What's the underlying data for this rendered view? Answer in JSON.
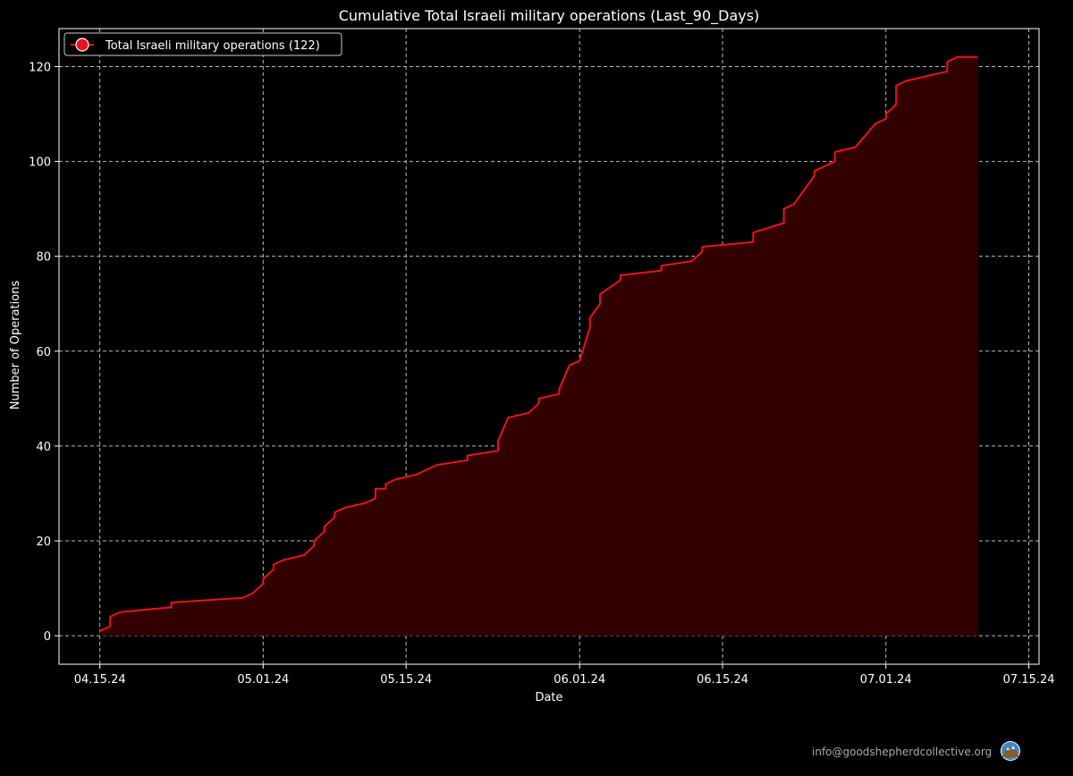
{
  "chart_data": {
    "type": "line",
    "title": "Cumulative Total Israeli military operations (Last_90_Days)",
    "xlabel": "Date",
    "ylabel": "Number of Operations",
    "x_tick_labels": [
      "04.15.24",
      "05.01.24",
      "05.15.24",
      "06.01.24",
      "06.15.24",
      "07.01.24",
      "07.15.24"
    ],
    "x_ticks": [
      "2024-04-15",
      "2024-05-01",
      "2024-05-15",
      "2024-06-01",
      "2024-06-15",
      "2024-07-01",
      "2024-07-15"
    ],
    "xlim": [
      "2024-04-11",
      "2024-07-16"
    ],
    "y_ticks": [
      0,
      20,
      40,
      60,
      80,
      100,
      120
    ],
    "ylim": [
      -6,
      128
    ],
    "grid": true,
    "legend": {
      "position": "top-left",
      "label": "Total Israeli military operations (122)"
    },
    "colors": {
      "line": "#e8141c",
      "fill": "#330000",
      "grid": "#bbbbbb",
      "background": "#000000"
    },
    "series": [
      {
        "name": "Total Israeli military operations (122)",
        "x": [
          "2024-04-15",
          "2024-04-16",
          "2024-04-16",
          "2024-04-17",
          "2024-04-22",
          "2024-04-22",
          "2024-04-29",
          "2024-04-30",
          "2024-05-01",
          "2024-05-01",
          "2024-05-02",
          "2024-05-02",
          "2024-05-03",
          "2024-05-05",
          "2024-05-06",
          "2024-05-06",
          "2024-05-07",
          "2024-05-07",
          "2024-05-08",
          "2024-05-08",
          "2024-05-09",
          "2024-05-11",
          "2024-05-12",
          "2024-05-12",
          "2024-05-13",
          "2024-05-13",
          "2024-05-14",
          "2024-05-16",
          "2024-05-17",
          "2024-05-18",
          "2024-05-21",
          "2024-05-21",
          "2024-05-24",
          "2024-05-24",
          "2024-05-25",
          "2024-05-27",
          "2024-05-28",
          "2024-05-28",
          "2024-05-30",
          "2024-05-30",
          "2024-05-31",
          "2024-06-01",
          "2024-06-02",
          "2024-06-02",
          "2024-06-03",
          "2024-06-03",
          "2024-06-05",
          "2024-06-05",
          "2024-06-09",
          "2024-06-09",
          "2024-06-12",
          "2024-06-13",
          "2024-06-13",
          "2024-06-18",
          "2024-06-18",
          "2024-06-21",
          "2024-06-21",
          "2024-06-22",
          "2024-06-24",
          "2024-06-24",
          "2024-06-25",
          "2024-06-26",
          "2024-06-26",
          "2024-06-28",
          "2024-06-30",
          "2024-07-01",
          "2024-07-01",
          "2024-07-02",
          "2024-07-02",
          "2024-07-03",
          "2024-07-05",
          "2024-07-07",
          "2024-07-07",
          "2024-07-08",
          "2024-07-08",
          "2024-07-09",
          "2024-07-09",
          "2024-07-10"
        ],
        "y": [
          1,
          2,
          4,
          5,
          6,
          7,
          8,
          9,
          11,
          12,
          14,
          15,
          16,
          17,
          19,
          20,
          22,
          23,
          25,
          26,
          27,
          28,
          29,
          31,
          31,
          32,
          33,
          34,
          35,
          36,
          37,
          38,
          39,
          41,
          46,
          47,
          49,
          50,
          51,
          52,
          57,
          58,
          65,
          67,
          70,
          72,
          75,
          76,
          77,
          78,
          79,
          81,
          82,
          83,
          85,
          87,
          90,
          91,
          97,
          98,
          99,
          100,
          102,
          103,
          108,
          109,
          110,
          112,
          116,
          117,
          118,
          119,
          121,
          122,
          122,
          122,
          122,
          122
        ]
      }
    ]
  },
  "footer": {
    "email": "info@goodshepherdcollective.org",
    "logo_icon": "mountain-logo-icon"
  }
}
